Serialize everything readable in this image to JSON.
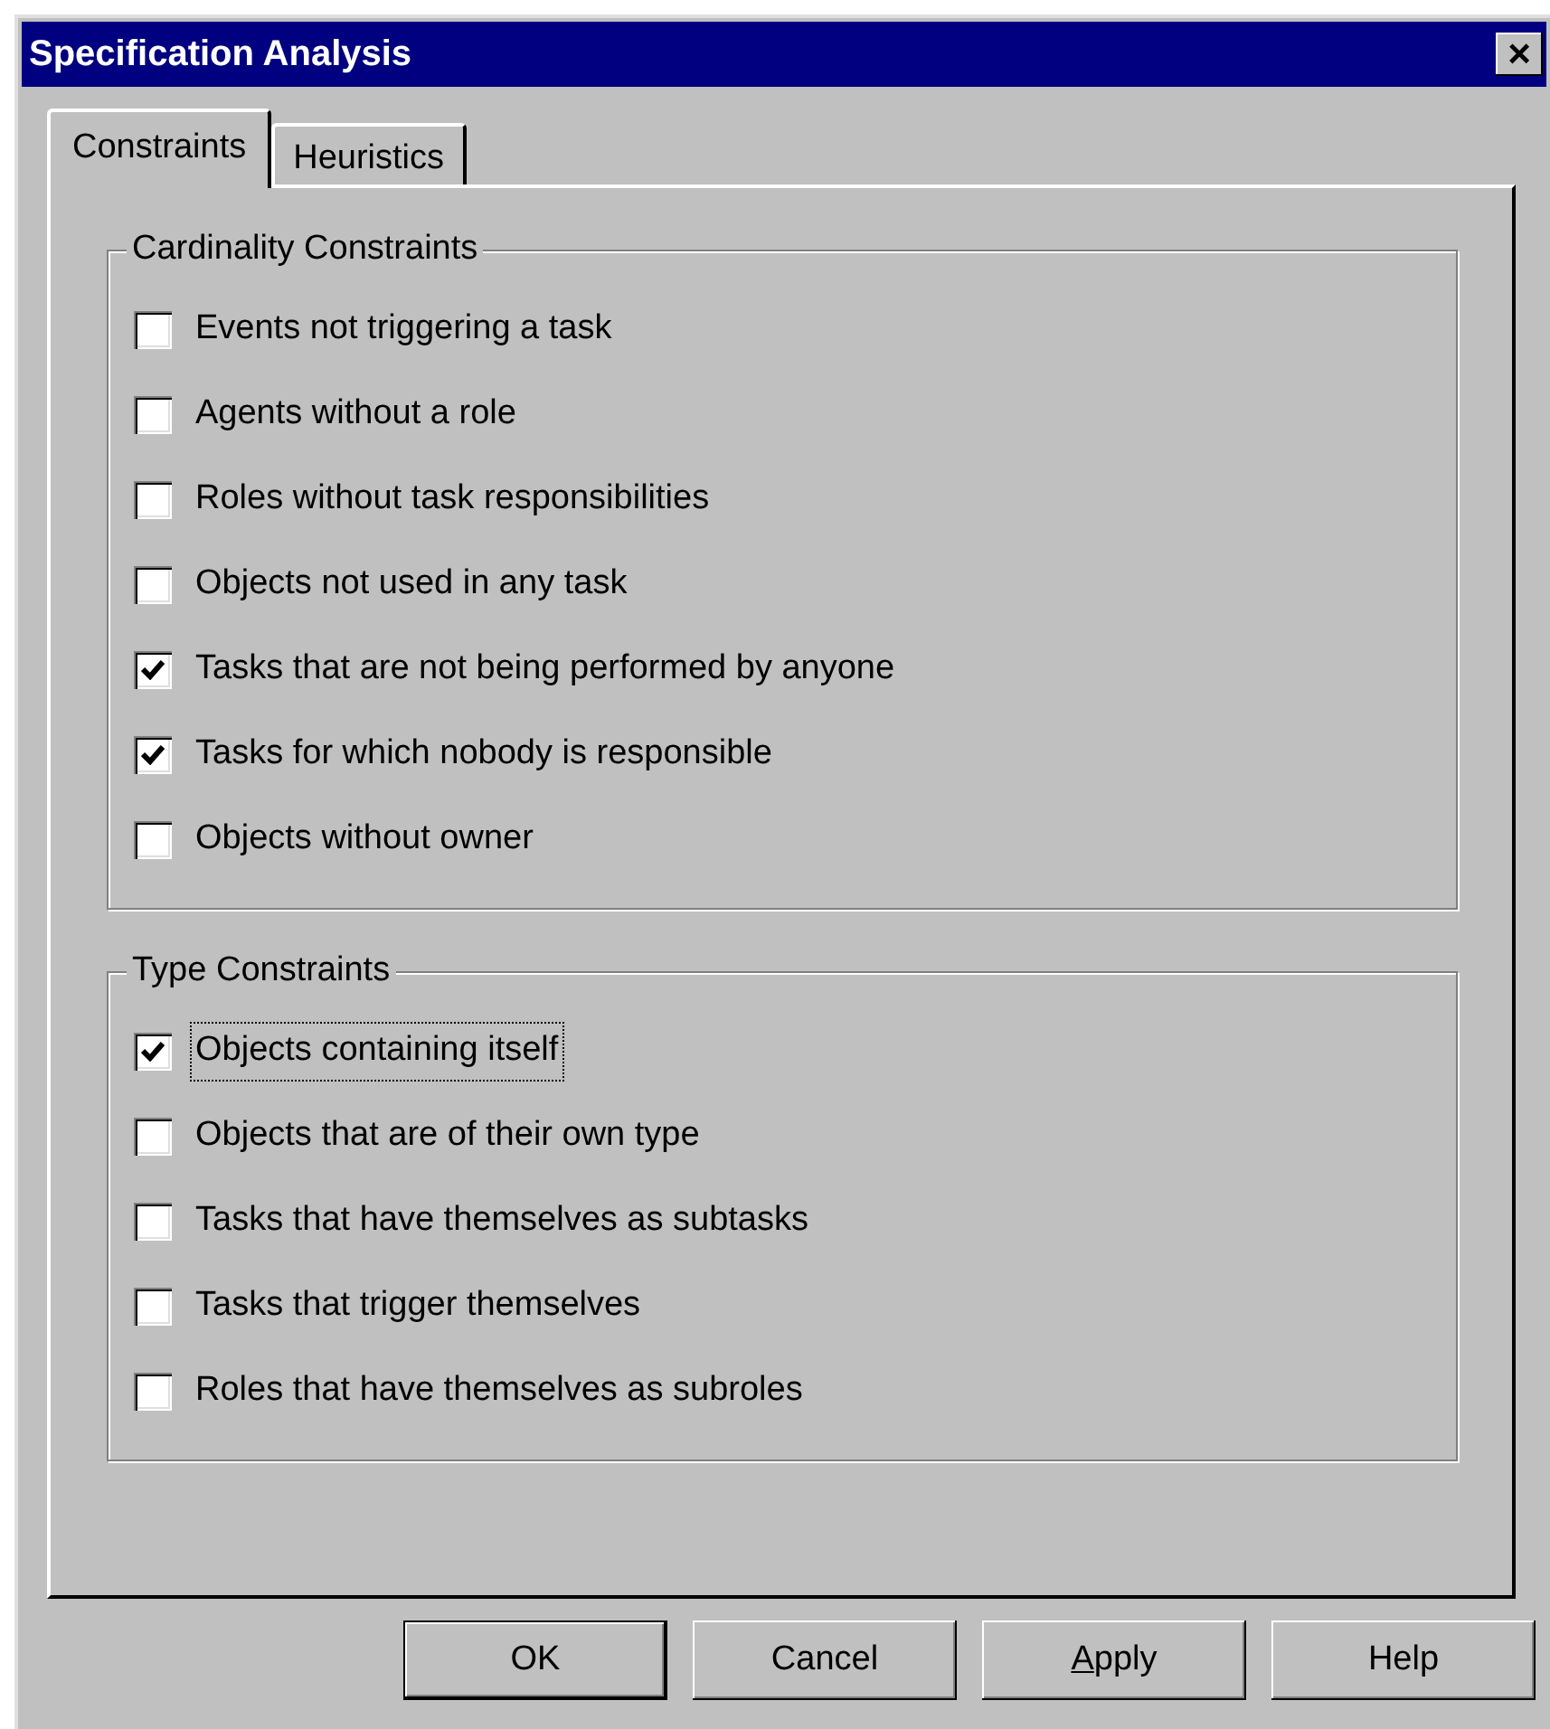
{
  "window": {
    "title": "Specification Analysis",
    "close": "×"
  },
  "tabs": [
    {
      "label": "Constraints",
      "selected": true
    },
    {
      "label": "Heuristics",
      "selected": false
    }
  ],
  "groups": [
    {
      "title": "Cardinality Constraints",
      "items": [
        {
          "label": "Events not triggering a task",
          "checked": false,
          "focused": false
        },
        {
          "label": "Agents without a role",
          "checked": false,
          "focused": false
        },
        {
          "label": "Roles without task responsibilities",
          "checked": false,
          "focused": false
        },
        {
          "label": "Objects not used in any task",
          "checked": false,
          "focused": false
        },
        {
          "label": "Tasks that are not being performed by anyone",
          "checked": true,
          "focused": false
        },
        {
          "label": "Tasks for which nobody is responsible",
          "checked": true,
          "focused": false
        },
        {
          "label": "Objects without owner",
          "checked": false,
          "focused": false
        }
      ]
    },
    {
      "title": "Type Constraints",
      "items": [
        {
          "label": "Objects containing itself",
          "checked": true,
          "focused": true
        },
        {
          "label": "Objects that are of their own type",
          "checked": false,
          "focused": false
        },
        {
          "label": "Tasks that have themselves as subtasks",
          "checked": false,
          "focused": false
        },
        {
          "label": "Tasks that trigger themselves",
          "checked": false,
          "focused": false
        },
        {
          "label": "Roles that have themselves as subroles",
          "checked": false,
          "focused": false
        }
      ]
    }
  ],
  "buttons": [
    {
      "label": "OK",
      "default": true,
      "mnemonic_first": false
    },
    {
      "label": "Cancel",
      "default": false,
      "mnemonic_first": false
    },
    {
      "label": "Apply",
      "default": false,
      "mnemonic_first": true
    },
    {
      "label": "Help",
      "default": false,
      "mnemonic_first": false
    }
  ]
}
